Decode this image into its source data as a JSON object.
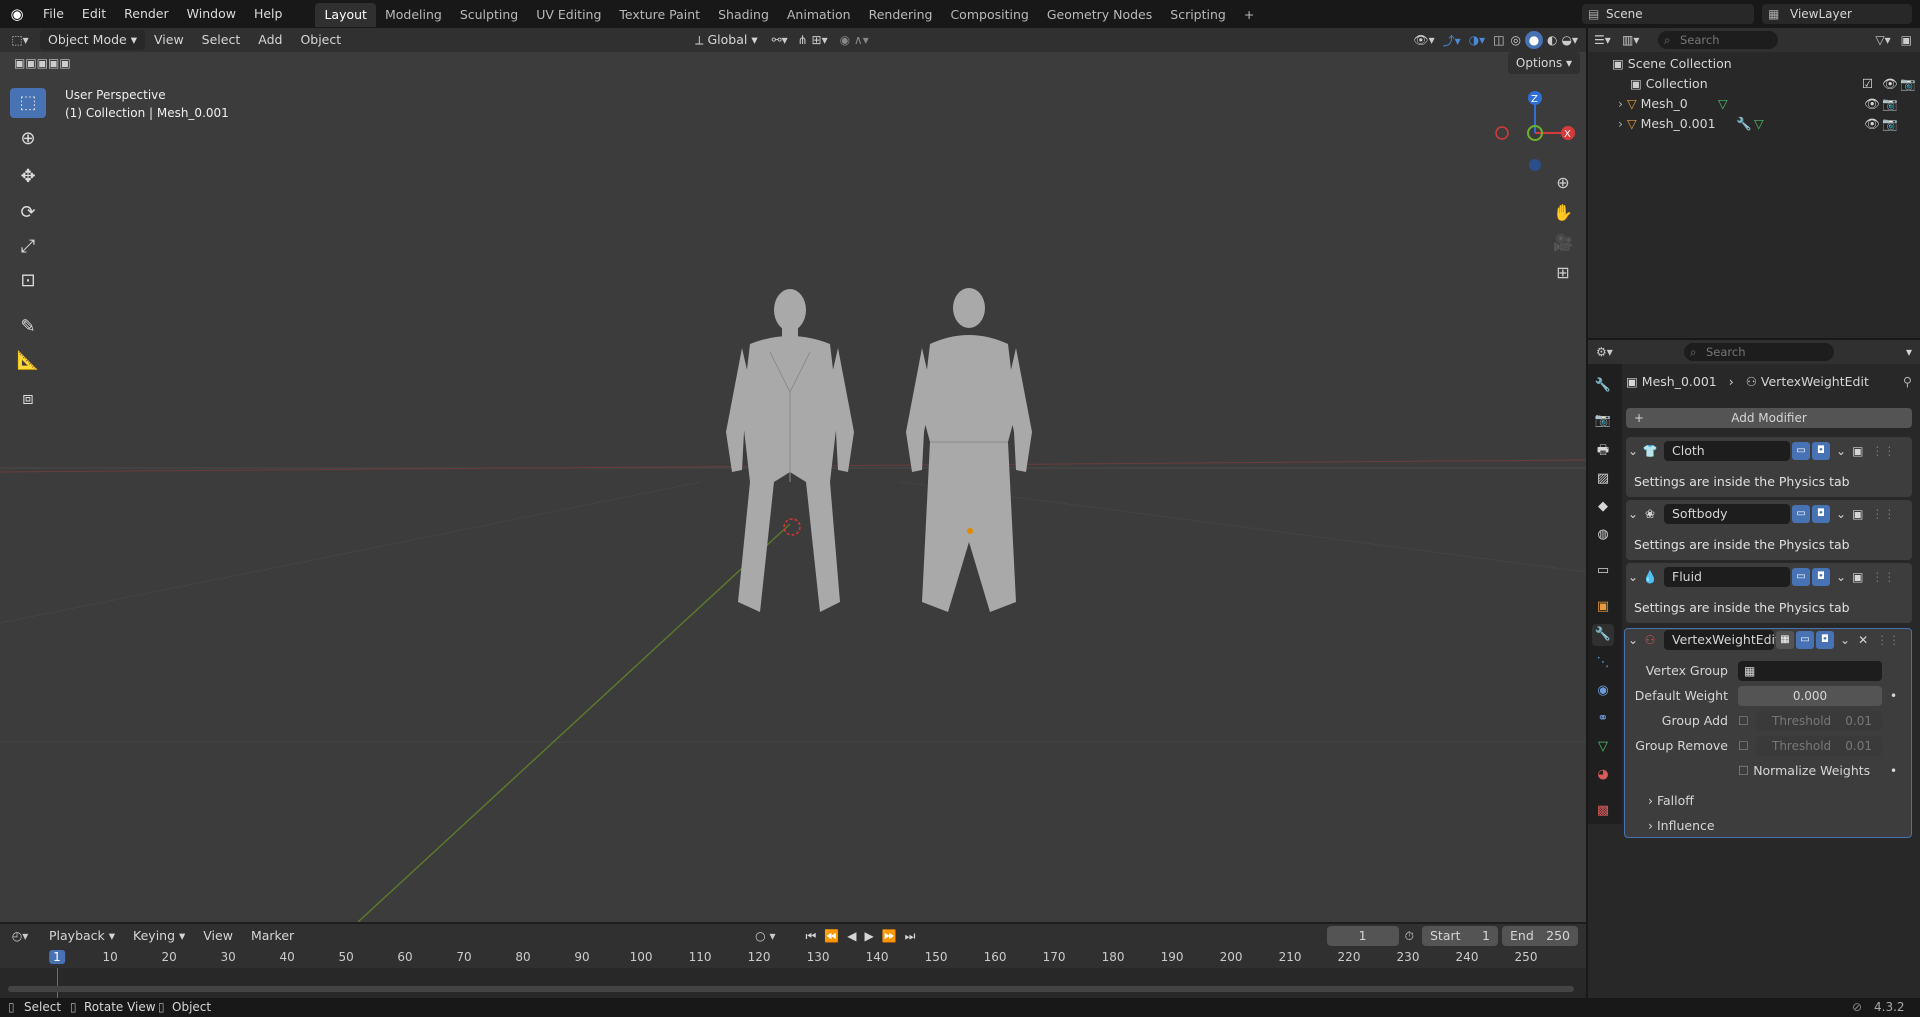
{
  "topbar": {
    "menus": [
      "File",
      "Edit",
      "Render",
      "Window",
      "Help"
    ],
    "workspaces": [
      "Layout",
      "Modeling",
      "Sculpting",
      "UV Editing",
      "Texture Paint",
      "Shading",
      "Animation",
      "Rendering",
      "Compositing",
      "Geometry Nodes",
      "Scripting"
    ],
    "add": "+",
    "scene": "Scene",
    "viewlayer": "ViewLayer"
  },
  "vpheader": {
    "mode": "Object Mode",
    "menus": [
      "View",
      "Select",
      "Add",
      "Object"
    ],
    "transform": "Global",
    "options": "Options"
  },
  "viewport": {
    "line1": "User Perspective",
    "line2": "(1) Collection | Mesh_0.001",
    "axes": {
      "x": "X",
      "y": "Y",
      "z": "Z"
    }
  },
  "outliner": {
    "search_placeholder": "Search",
    "items": [
      "Scene Collection",
      "Collection",
      "Mesh_0",
      "Mesh_0.001"
    ]
  },
  "props": {
    "search_placeholder": "Search",
    "breadcrumb_obj": "Mesh_0.001",
    "breadcrumb_mod": "VertexWeightEdit",
    "add_modifier": "Add Modifier",
    "modifiers": [
      {
        "name": "Cloth",
        "note": "Settings are inside the Physics tab"
      },
      {
        "name": "Softbody",
        "note": "Settings are inside the Physics tab"
      },
      {
        "name": "Fluid",
        "note": "Settings are inside the Physics tab"
      }
    ],
    "vwe": {
      "name": "VertexWeightEdit",
      "vertex_group_label": "Vertex Group",
      "default_weight_label": "Default Weight",
      "default_weight": "0.000",
      "group_add_label": "Group Add",
      "group_remove_label": "Group Remove",
      "threshold_label": "Threshold",
      "threshold_add": "0.01",
      "threshold_remove": "0.01",
      "normalize_label": "Normalize Weights",
      "falloff": "Falloff",
      "influence": "Influence"
    }
  },
  "timeline": {
    "menus": [
      "Playback",
      "Keying",
      "View",
      "Marker"
    ],
    "current_frame": "1",
    "start_label": "Start",
    "start": "1",
    "end_label": "End",
    "end": "250",
    "ticks": [
      "1",
      "10",
      "20",
      "30",
      "40",
      "50",
      "60",
      "70",
      "80",
      "90",
      "100",
      "110",
      "120",
      "130",
      "140",
      "150",
      "160",
      "170",
      "180",
      "190",
      "200",
      "210",
      "220",
      "230",
      "240",
      "250"
    ]
  },
  "status": {
    "select": "Select",
    "rotate": "Rotate View",
    "object": "Object",
    "version": "4.3.2"
  }
}
